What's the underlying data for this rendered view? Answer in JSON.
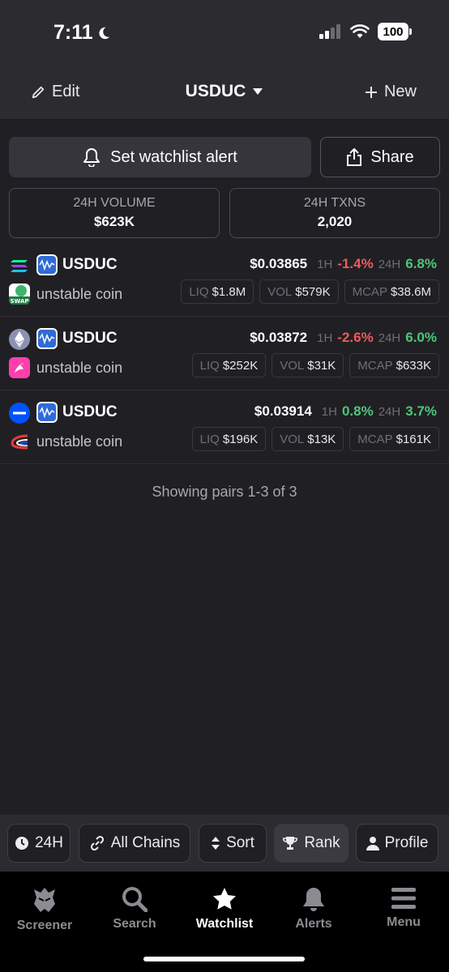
{
  "status": {
    "time": "7:11",
    "battery": "100"
  },
  "header": {
    "edit_label": "Edit",
    "title": "USDUC",
    "new_label": "New"
  },
  "actions": {
    "alert_label": "Set watchlist alert",
    "share_label": "Share"
  },
  "stats": [
    {
      "label": "24H VOLUME",
      "value": "$623K"
    },
    {
      "label": "24H TXNS",
      "value": "2,020"
    }
  ],
  "pairs": [
    {
      "symbol": "USDUC",
      "name": "unstable coin",
      "price": "$0.03865",
      "h1_label": "1H",
      "h1": "-1.4%",
      "h24_label": "24H",
      "h24": "6.8%",
      "liq_label": "LIQ",
      "liq": "$1.8M",
      "vol_label": "VOL",
      "vol": "$579K",
      "mcap_label": "MCAP",
      "mcap": "$38.6M",
      "chain_icon": "solana-icon",
      "dex_icon": "swap-dex-icon",
      "dex_text": "SWAP"
    },
    {
      "symbol": "USDUC",
      "name": "unstable coin",
      "price": "$0.03872",
      "h1_label": "1H",
      "h1": "-2.6%",
      "h24_label": "24H",
      "h24": "6.0%",
      "liq_label": "LIQ",
      "liq": "$252K",
      "vol_label": "VOL",
      "vol": "$31K",
      "mcap_label": "MCAP",
      "mcap": "$633K",
      "chain_icon": "ethereum-icon",
      "dex_icon": "uniswap-icon"
    },
    {
      "symbol": "USDUC",
      "name": "unstable coin",
      "price": "$0.03914",
      "h1_label": "1H",
      "h1": "0.8%",
      "h24_label": "24H",
      "h24": "3.7%",
      "liq_label": "LIQ",
      "liq": "$196K",
      "vol_label": "VOL",
      "vol": "$13K",
      "mcap_label": "MCAP",
      "mcap": "$161K",
      "chain_icon": "base-icon",
      "dex_icon": "aerodrome-icon"
    }
  ],
  "showing_text": "Showing pairs 1-3 of 3",
  "filters": {
    "timeframe": "24H",
    "chains": "All Chains",
    "sort": "Sort",
    "rank": "Rank",
    "profile": "Profile"
  },
  "tabs": {
    "screener": "Screener",
    "search": "Search",
    "watchlist": "Watchlist",
    "alerts": "Alerts",
    "menu": "Menu"
  },
  "colors": {
    "negative": "#ee5b5b",
    "positive": "#4fc57a",
    "background": "#202024",
    "token_blue": "#2f6bd6"
  }
}
